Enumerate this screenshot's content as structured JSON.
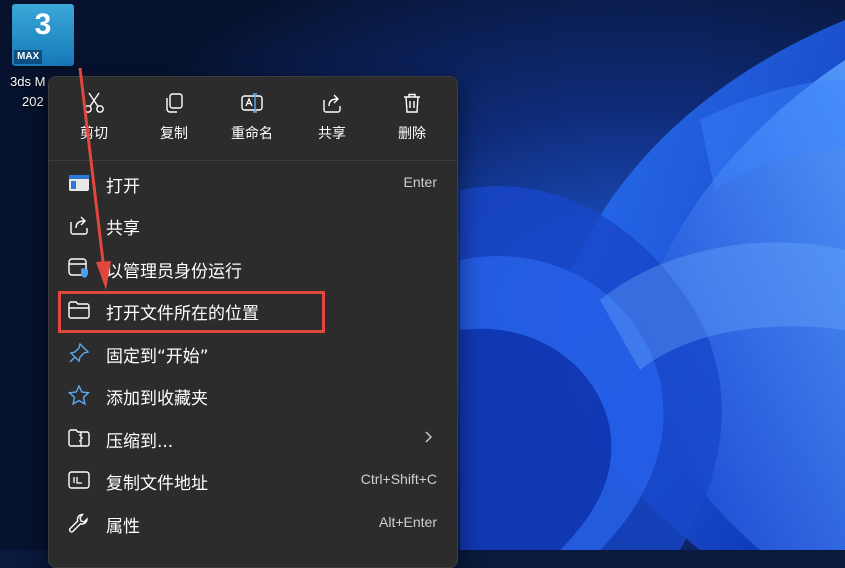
{
  "desktop_icon": {
    "tile_number": "3",
    "tile_badge": "MAX",
    "caption_line1": "3ds M",
    "caption_line2": "202"
  },
  "toolbar": [
    {
      "label": "剪切",
      "icon": "cut-icon"
    },
    {
      "label": "复制",
      "icon": "copy-icon"
    },
    {
      "label": "重命名",
      "icon": "rename-icon"
    },
    {
      "label": "共享",
      "icon": "share-icon"
    },
    {
      "label": "删除",
      "icon": "delete-icon"
    }
  ],
  "items": [
    {
      "label": "打开",
      "shortcut": "Enter",
      "icon": "open-app-icon"
    },
    {
      "label": "共享",
      "shortcut": "",
      "icon": "share-icon"
    },
    {
      "label": "以管理员身份运行",
      "shortcut": "",
      "icon": "admin-shield-icon"
    },
    {
      "label": "打开文件所在的位置",
      "shortcut": "",
      "icon": "folder-icon",
      "highlighted": true
    },
    {
      "label": "固定到“开始”",
      "shortcut": "",
      "icon": "pin-icon"
    },
    {
      "label": "添加到收藏夹",
      "shortcut": "",
      "icon": "star-icon"
    },
    {
      "label": "压缩到...",
      "shortcut": "",
      "icon": "compress-folder-icon",
      "submenu": true
    },
    {
      "label": "复制文件地址",
      "shortcut": "Ctrl+Shift+C",
      "icon": "copy-path-icon"
    },
    {
      "label": "属性",
      "shortcut": "Alt+Enter",
      "icon": "wrench-icon"
    }
  ],
  "colors": {
    "menu_bg": "#2c2c2c",
    "highlight_box": "#e0473f",
    "arrow": "#e0473f",
    "icon_accent": "#5aa9f0"
  }
}
